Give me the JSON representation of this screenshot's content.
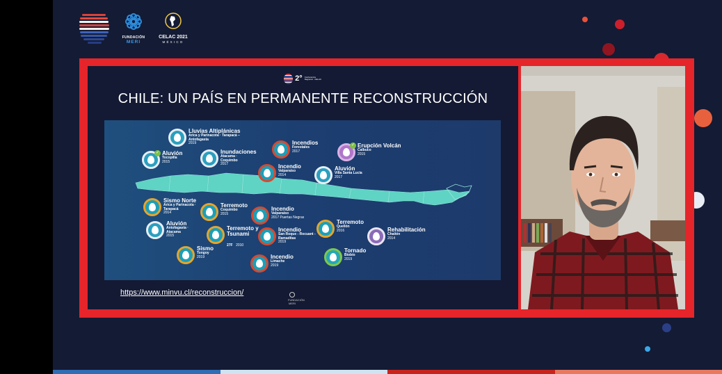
{
  "header": {
    "meri_logo": {
      "line1": "FUNDACIÓN",
      "line2": "MERI"
    },
    "celac_logo": {
      "line1": "CELAC 2021",
      "line2": "MÉXICO"
    }
  },
  "slide": {
    "conference_badge": {
      "number": "2°",
      "text": "Conferencia Regional · CELAC"
    },
    "title": "CHILE: UN PAÍS EN PERMANENTE RECONSTRUCCIÓN",
    "url": "https://www.minvu.cl/reconstruccion/",
    "footer_logo_text": "FUNDACIÓN MERI",
    "events": [
      {
        "name": "Lluvias Altiplánicas",
        "place": "Arica y Parinacota · Tarapacá – Antofagasta",
        "year": "2019",
        "icon": "rain-icon",
        "ring": "white"
      },
      {
        "name": "Aluvión",
        "place": "Tocopilla",
        "year": "2015",
        "icon": "landslide-icon",
        "ring": "white",
        "check": true
      },
      {
        "name": "Inundaciones",
        "place": "Atacama · Coquimbo",
        "year": "2017",
        "icon": "flood-icon",
        "ring": "white"
      },
      {
        "name": "Incendios",
        "place": "Forestales",
        "year": "2017",
        "icon": "fire-icon",
        "ring": "red"
      },
      {
        "name": "Incendio",
        "place": "Valparaíso",
        "year": "2014",
        "icon": "fire-icon",
        "ring": "red"
      },
      {
        "name": "Erupción Volcán",
        "place": "Calbuco",
        "year": "2015",
        "icon": "volcano-icon",
        "ring": "purple",
        "check": true
      },
      {
        "name": "Aluvión",
        "place": "Villa Santa Lucía",
        "year": "2017",
        "icon": "landslide-icon",
        "ring": "white"
      },
      {
        "name": "Sismo Norte",
        "place": "Arica y Parinacota · Tarapacá",
        "year": "2014",
        "icon": "earthquake-icon",
        "ring": "orange"
      },
      {
        "name": "Terremoto",
        "place": "Coquimbo",
        "year": "2015",
        "icon": "earthquake-icon",
        "ring": "orange"
      },
      {
        "name": "Incendio",
        "place": "Valparaíso",
        "year": "2017 Puertas Negras",
        "icon": "fire-icon",
        "ring": "red"
      },
      {
        "name": "Aluvión",
        "place": "Antofagasta · Atacama",
        "year": "2015",
        "icon": "landslide-icon",
        "ring": "white"
      },
      {
        "name": "Terremoto y Tsunami",
        "place": "27F",
        "year": "2010",
        "icon": "tsunami-icon",
        "ring": "orange"
      },
      {
        "name": "Incendio",
        "place": "San Roque - Rocuant - Ramaditas",
        "year": "2019",
        "icon": "fire-icon",
        "ring": "red"
      },
      {
        "name": "Terremoto",
        "place": "Quellón",
        "year": "2016",
        "icon": "earthquake-icon",
        "ring": "orange"
      },
      {
        "name": "Rehabilitación",
        "place": "Chaitén",
        "year": "2014",
        "icon": "volcano-icon",
        "ring": "purple2"
      },
      {
        "name": "Sismo",
        "place": "Tongoy",
        "year": "2019",
        "icon": "earthquake-icon",
        "ring": "orange"
      },
      {
        "name": "Incendio",
        "place": "Limache",
        "year": "2019",
        "icon": "fire-icon",
        "ring": "red"
      },
      {
        "name": "Tornado",
        "place": "Biobío",
        "year": "2019",
        "icon": "tornado-icon",
        "ring": "green"
      }
    ]
  },
  "colors": {
    "frame": "#e5252a",
    "background": "#141b34",
    "map_land": "#5fd3c4",
    "bottom_bar": [
      "#2f6db5",
      "#cfe3f1",
      "#c8241e",
      "#e8795f"
    ]
  }
}
